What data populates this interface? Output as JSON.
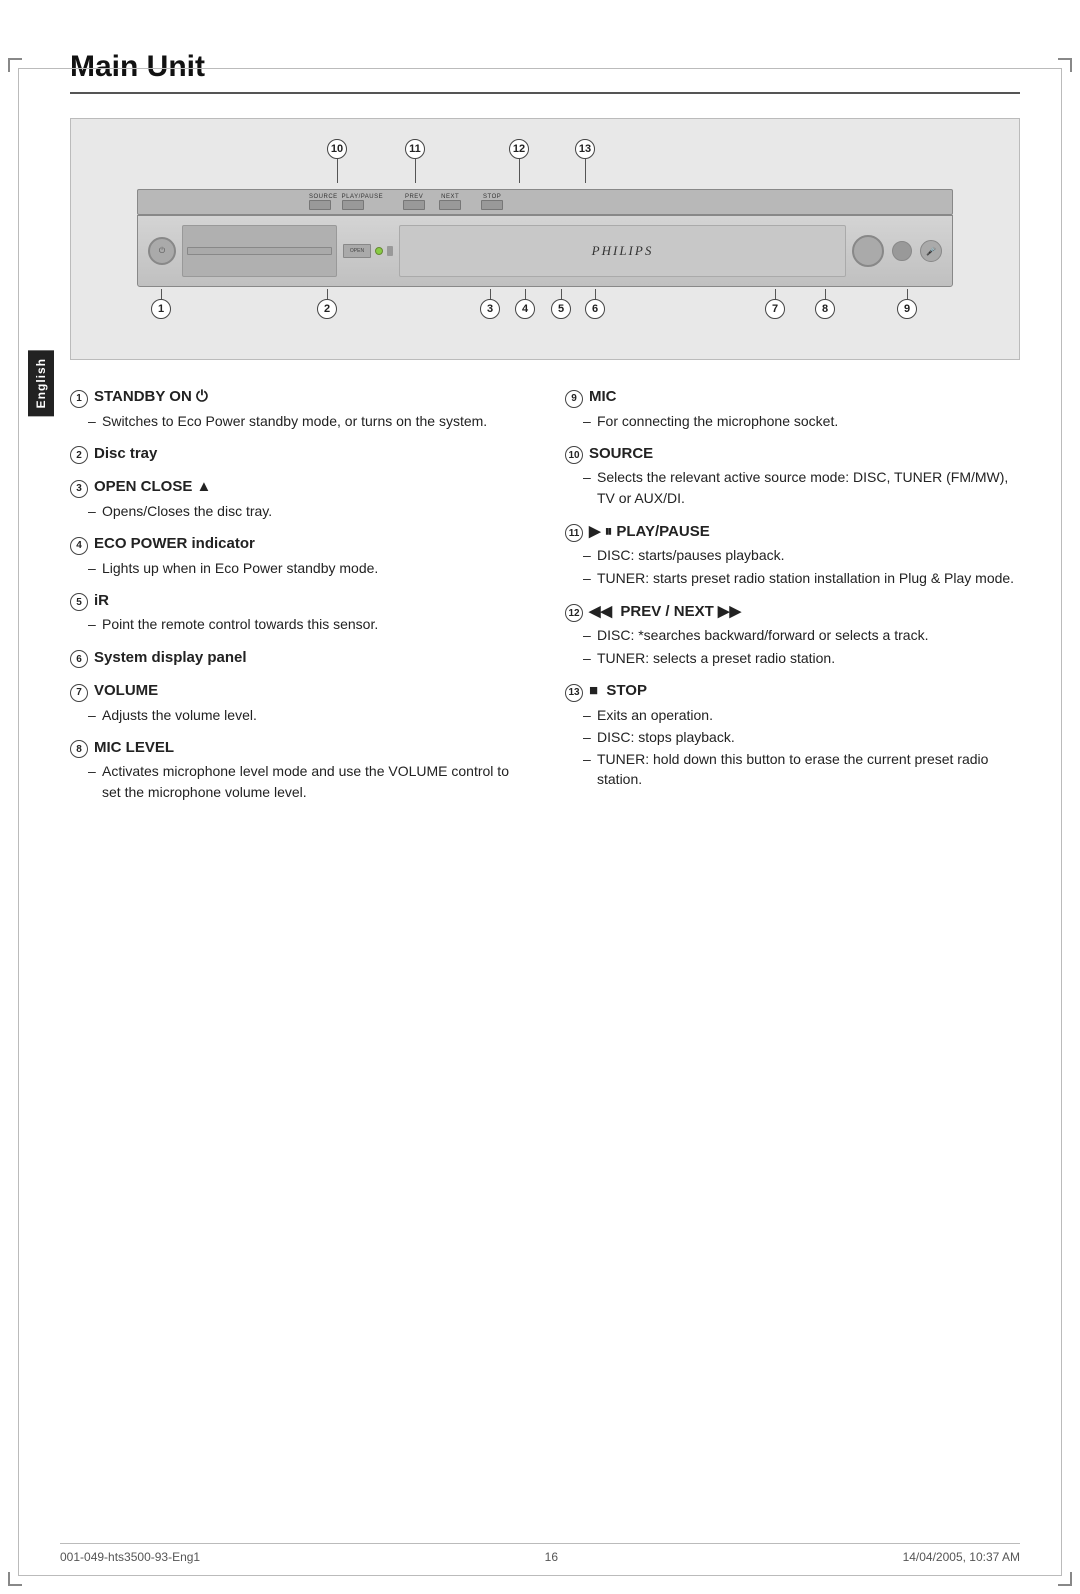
{
  "page": {
    "title": "Main Unit",
    "sidebar_label": "English",
    "footer_left": "001-049-hts3500-93-Eng1",
    "footer_center": "16",
    "footer_right": "14/04/2005, 10:37 AM"
  },
  "items": [
    {
      "num": "1",
      "title": "STANDBY ON ⏻",
      "bullets": [
        "Switches to Eco Power standby mode, or turns on the system."
      ]
    },
    {
      "num": "2",
      "title": "Disc tray",
      "bullets": []
    },
    {
      "num": "3",
      "title": "OPEN CLOSE ▲",
      "bullets": [
        "Opens/Closes the disc tray."
      ]
    },
    {
      "num": "4",
      "title": "ECO POWER indicator",
      "bullets": [
        "Lights up when in Eco Power standby mode."
      ]
    },
    {
      "num": "5",
      "title": "iR",
      "bullets": [
        "Point the remote control towards this sensor."
      ]
    },
    {
      "num": "6",
      "title": "System display panel",
      "bullets": []
    },
    {
      "num": "7",
      "title": "VOLUME",
      "bullets": [
        "Adjusts the volume level."
      ]
    },
    {
      "num": "8",
      "title": "MIC LEVEL",
      "bullets": [
        "Activates microphone level mode and use the VOLUME control to set the microphone volume level."
      ]
    },
    {
      "num": "9",
      "title": "MIC",
      "bullets": [
        "For connecting the microphone socket."
      ]
    },
    {
      "num": "10",
      "title": "SOURCE",
      "bullets": [
        "Selects the relevant active source mode: DISC, TUNER (FM/MW), TV or AUX/DI."
      ]
    },
    {
      "num": "11",
      "title": "▶ ⏸ PLAY/PAUSE",
      "bullets": [
        "DISC: starts/pauses playback.",
        "TUNER: starts preset radio station installation in Plug & Play mode."
      ]
    },
    {
      "num": "12",
      "title": "◀◀  PREV / NEXT ▶▶",
      "bullets": [
        "DISC: *searches backward/forward or selects a track.",
        "TUNER: selects a preset radio station."
      ]
    },
    {
      "num": "13",
      "title": "■  STOP",
      "bullets": [
        "Exits an operation.",
        "DISC: stops playback.",
        "TUNER: hold down this button to erase the current preset radio station."
      ]
    }
  ]
}
